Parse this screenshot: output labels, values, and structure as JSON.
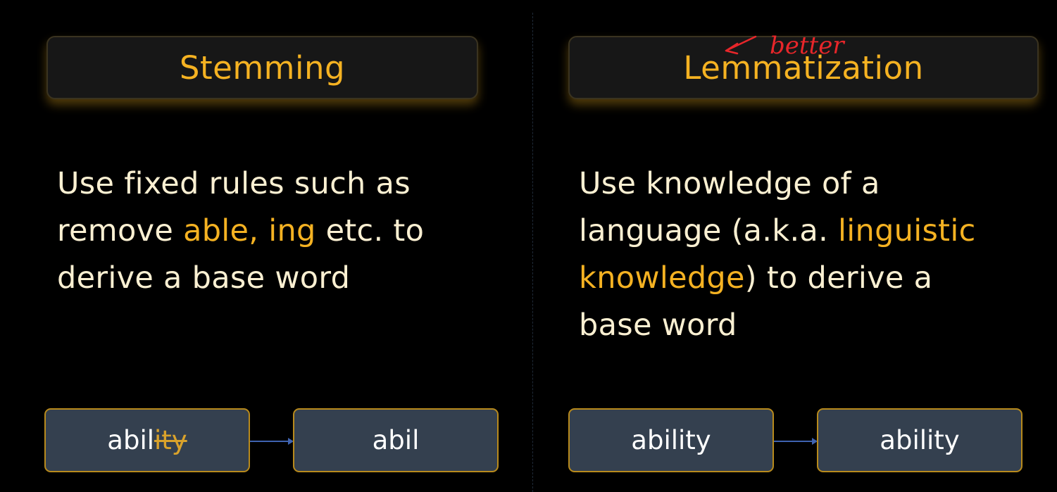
{
  "stemming": {
    "title": "Stemming",
    "body": {
      "line1": "Use fixed rules such as",
      "line2_prefix": "remove ",
      "line2_highlight": "able, ing",
      "line2_suffix": " etc. to",
      "line3": "derive a base word"
    },
    "example": {
      "input_kept": "abil",
      "input_struck": "ity",
      "output": "abil"
    }
  },
  "lemmatization": {
    "title": "Lemmatization",
    "annotation": "better",
    "body": {
      "line1": "Use knowledge of a",
      "line2_prefix": "language (a.k.a. ",
      "line2_highlight": "linguistic",
      "line3_highlight": "knowledge",
      "line3_suffix": ") to derive a",
      "line4": "base word"
    },
    "example": {
      "input": "ability",
      "output": "ability"
    }
  },
  "colors": {
    "background": "#000000",
    "accent": "#f5b222",
    "text": "#fbf0d2",
    "box_fill": "#34404f",
    "annotation_ink": "#e8262a"
  }
}
